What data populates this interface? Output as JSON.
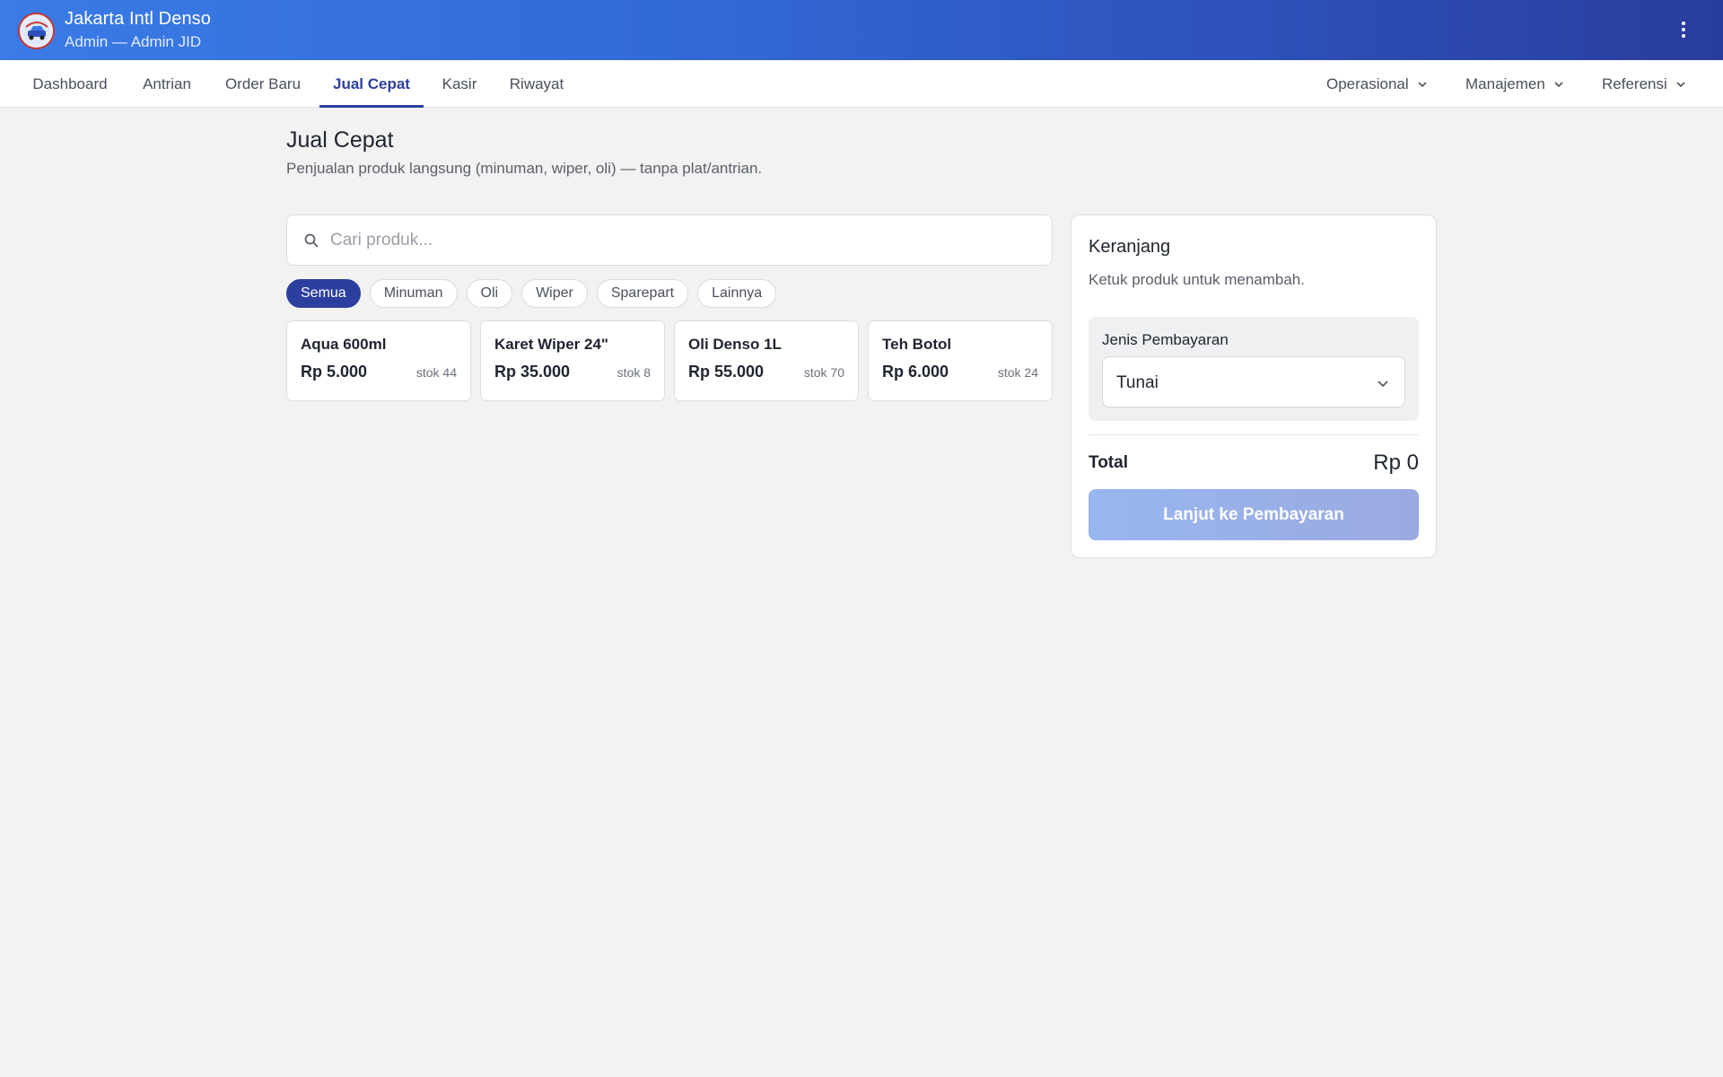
{
  "header": {
    "title": "Jakarta Intl Denso",
    "subtitle": "Admin — Admin JID"
  },
  "nav": {
    "tabs": [
      {
        "label": "Dashboard"
      },
      {
        "label": "Antrian"
      },
      {
        "label": "Order Baru"
      },
      {
        "label": "Jual Cepat",
        "active": true
      },
      {
        "label": "Kasir"
      },
      {
        "label": "Riwayat"
      }
    ],
    "menus": [
      {
        "label": "Operasional"
      },
      {
        "label": "Manajemen"
      },
      {
        "label": "Referensi"
      }
    ]
  },
  "page": {
    "title": "Jual Cepat",
    "subtitle": "Penjualan produk langsung (minuman, wiper, oli) — tanpa plat/antrian."
  },
  "search": {
    "placeholder": "Cari produk...",
    "value": ""
  },
  "filters": [
    {
      "label": "Semua",
      "active": true
    },
    {
      "label": "Minuman"
    },
    {
      "label": "Oli"
    },
    {
      "label": "Wiper"
    },
    {
      "label": "Sparepart"
    },
    {
      "label": "Lainnya"
    }
  ],
  "products": [
    {
      "name": "Aqua 600ml",
      "price": "Rp 5.000",
      "stock": "stok 44"
    },
    {
      "name": "Karet Wiper 24\"",
      "price": "Rp 35.000",
      "stock": "stok 8"
    },
    {
      "name": "Oli Denso 1L",
      "price": "Rp 55.000",
      "stock": "stok 70"
    },
    {
      "name": "Teh Botol",
      "price": "Rp 6.000",
      "stock": "stok 24"
    }
  ],
  "cart": {
    "title": "Keranjang",
    "empty_text": "Ketuk produk untuk menambah.",
    "payment_label": "Jenis Pembayaran",
    "payment_value": "Tunai",
    "total_label": "Total",
    "total_value": "Rp 0",
    "checkout_label": "Lanjut ke Pembayaran"
  },
  "colors": {
    "primary": "#2d3f9e",
    "header_start": "#3a7be6",
    "header_end": "#293d9c",
    "button_disabled": "#98b6ef",
    "logo_accent": "#c8362f"
  },
  "icons": {
    "logo": "denso-logo-icon",
    "menu": "kebab-menu-icon",
    "search": "search-icon",
    "dropdown": "chevron-down-icon"
  }
}
